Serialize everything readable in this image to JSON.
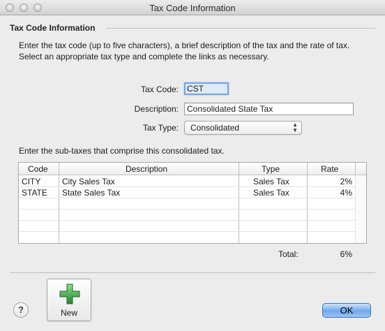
{
  "window": {
    "title": "Tax Code Information"
  },
  "section": {
    "title": "Tax Code Information"
  },
  "intro": "Enter the tax code (up to five characters), a brief description of the tax and the rate of tax.  Select an appropriate tax type and complete the links as necessary.",
  "form": {
    "code_label": "Tax Code:",
    "code_value": "CST",
    "description_label": "Description:",
    "description_value": "Consolidated State Tax",
    "type_label": "Tax Type:",
    "type_value": "Consolidated"
  },
  "subtaxes": {
    "caption": "Enter the sub-taxes that comprise this consolidated tax.",
    "columns": {
      "code": "Code",
      "description": "Description",
      "type": "Type",
      "rate": "Rate"
    },
    "rows": [
      {
        "code": "CITY",
        "description": "City Sales Tax",
        "type": "Sales Tax",
        "rate": "2%"
      },
      {
        "code": "STATE",
        "description": "State Sales Tax",
        "type": "Sales Tax",
        "rate": "4%"
      }
    ]
  },
  "total": {
    "label": "Total:",
    "value": "6%"
  },
  "buttons": {
    "help": "?",
    "new": "New",
    "ok": "OK"
  },
  "icons": {
    "help": "question-mark-icon",
    "new": "green-plus-icon"
  },
  "colors": {
    "accent": "#6fa8ec",
    "plus_green": "#2f9e44",
    "focus_ring": "#6fa7e5"
  }
}
